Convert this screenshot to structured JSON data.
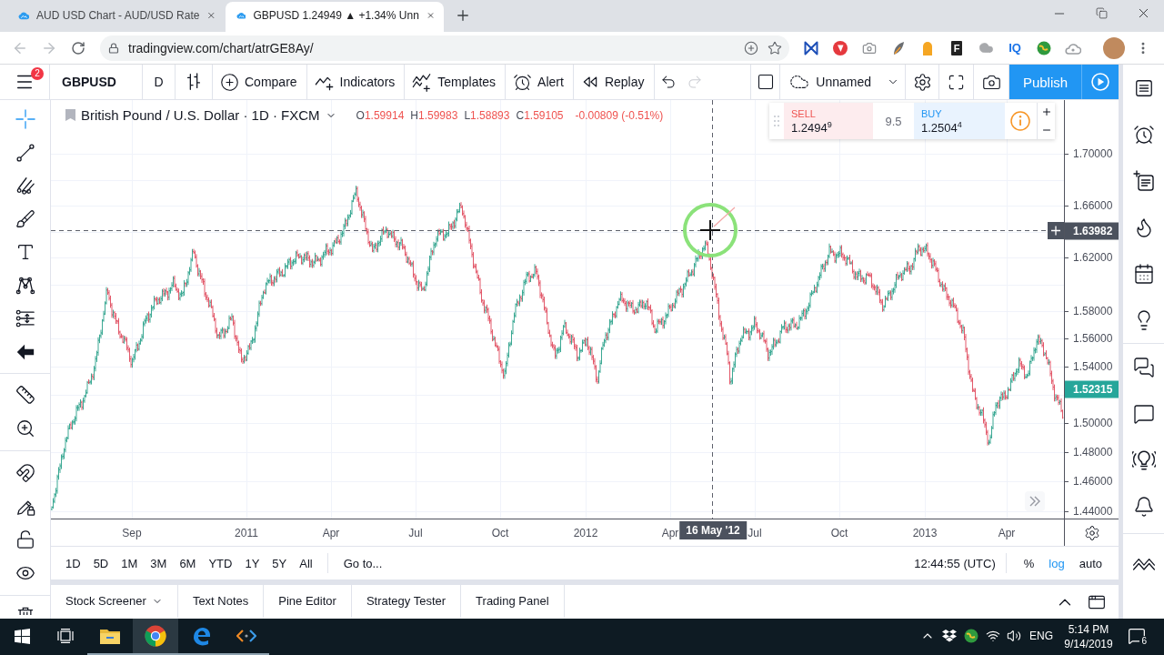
{
  "browser": {
    "tabs": [
      {
        "title": "AUD USD Chart - AUD/USD Rate",
        "selected": false
      },
      {
        "title": "GBPUSD 1.24949 ▲ +1.34% Unn",
        "selected": true
      }
    ],
    "url": "tradingview.com/chart/atrGE8Ay/",
    "extension_labels": [
      "F",
      "IQ"
    ]
  },
  "toolbar": {
    "menu_badge": "2",
    "symbol": "GBPUSD",
    "interval": "D",
    "compare": "Compare",
    "indicators": "Indicators",
    "templates": "Templates",
    "alert": "Alert",
    "replay": "Replay",
    "undo": {
      "disabled": false
    },
    "redo": {
      "disabled": true
    },
    "layout_name": "Unnamed",
    "publish": "Publish"
  },
  "drawing_tools": [
    {
      "selected": true
    },
    {
      "selected": false
    },
    {
      "selected": false
    },
    {
      "selected": false
    },
    {
      "selected": false
    },
    {
      "selected": false
    },
    {
      "selected": false
    },
    {
      "selected": false
    },
    {
      "selected": false
    },
    {
      "selected": false
    }
  ],
  "legend": {
    "title": "British Pound / U.S. Dollar · 1D · FXCM",
    "ohlc": [
      {
        "label": "O",
        "value": "1.59914"
      },
      {
        "label": "H",
        "value": "1.59983"
      },
      {
        "label": "L",
        "value": "1.58893"
      },
      {
        "label": "C",
        "value": "1.59105"
      }
    ],
    "change": "-0.00809 (-0.51%)"
  },
  "trade_widget": {
    "sell": {
      "label": "SELL",
      "price": "1.2494$^{9}$"
    },
    "spread": "9.5",
    "buy": {
      "label": "BUY",
      "price": "1.2504$^{4}$"
    }
  },
  "price_axis": {
    "ticks": [
      "1.70000",
      "1.66000",
      "1.62000",
      "1.58000",
      "1.56000",
      "1.54000",
      "1.50000",
      "1.48000",
      "1.46000",
      "1.44000"
    ],
    "crosshair_label": "1.63982",
    "last_price_label": "1.52315"
  },
  "time_axis": {
    "ticks": [
      "Sep",
      "2011",
      "Apr",
      "Jul",
      "Oct",
      "2012",
      "Apr",
      "Jul",
      "Oct",
      "2013",
      "Apr"
    ],
    "crosshair_label": "16 May '12"
  },
  "range_bar": {
    "ranges": [
      {
        "label": "1D",
        "selected": false
      },
      {
        "label": "5D",
        "selected": false
      },
      {
        "label": "1M",
        "selected": false
      },
      {
        "label": "3M",
        "selected": false
      },
      {
        "label": "6M",
        "selected": false
      },
      {
        "label": "YTD",
        "selected": false
      },
      {
        "label": "1Y",
        "selected": false
      },
      {
        "label": "5Y",
        "selected": false
      },
      {
        "label": "All",
        "selected": false
      }
    ],
    "goto": "Go to...",
    "clock": "12:44:55 (UTC)",
    "scale_options": [
      {
        "label": "%",
        "selected": false
      },
      {
        "label": "log",
        "selected": true
      },
      {
        "label": "auto",
        "selected": false
      }
    ]
  },
  "bottom_panel": {
    "tabs": [
      {
        "label": "Stock Screener",
        "selected": false
      },
      {
        "label": "Text Notes",
        "selected": false
      },
      {
        "label": "Pine Editor",
        "selected": false
      },
      {
        "label": "Strategy Tester",
        "selected": false
      },
      {
        "label": "Trading Panel",
        "selected": false
      }
    ]
  },
  "taskbar": {
    "language": "ENG",
    "time": "5:14 PM",
    "date": "9/14/2019",
    "notification_count": "6"
  }
}
